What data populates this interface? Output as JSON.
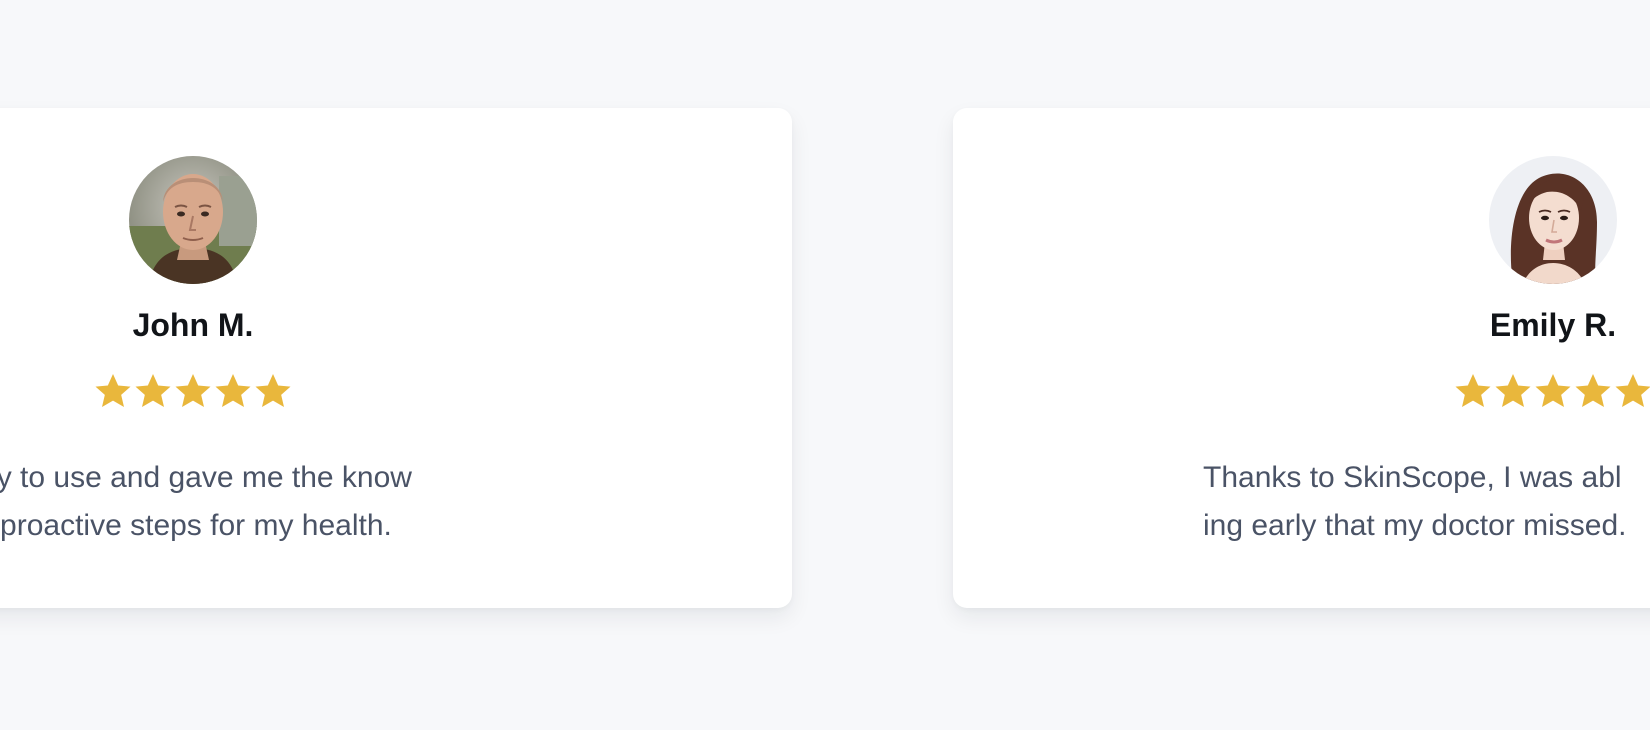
{
  "colors": {
    "background": "#f7f8fa",
    "card": "#ffffff",
    "name_text": "#111418",
    "quote_text": "#4a5366",
    "star": "#e9b73c"
  },
  "testimonials": [
    {
      "name": "John M.",
      "rating": 5,
      "rating_max": 5,
      "avatar_icon": "man-portrait",
      "quote_lines": [
        "s easy to use and gave me the know",
        "take proactive steps for my health."
      ]
    },
    {
      "name": "Emily R.",
      "rating": 5,
      "rating_max": 5,
      "avatar_icon": "woman-portrait",
      "quote_lines": [
        "Thanks to SkinScope, I was abl",
        "ing early that my doctor missed."
      ]
    }
  ]
}
